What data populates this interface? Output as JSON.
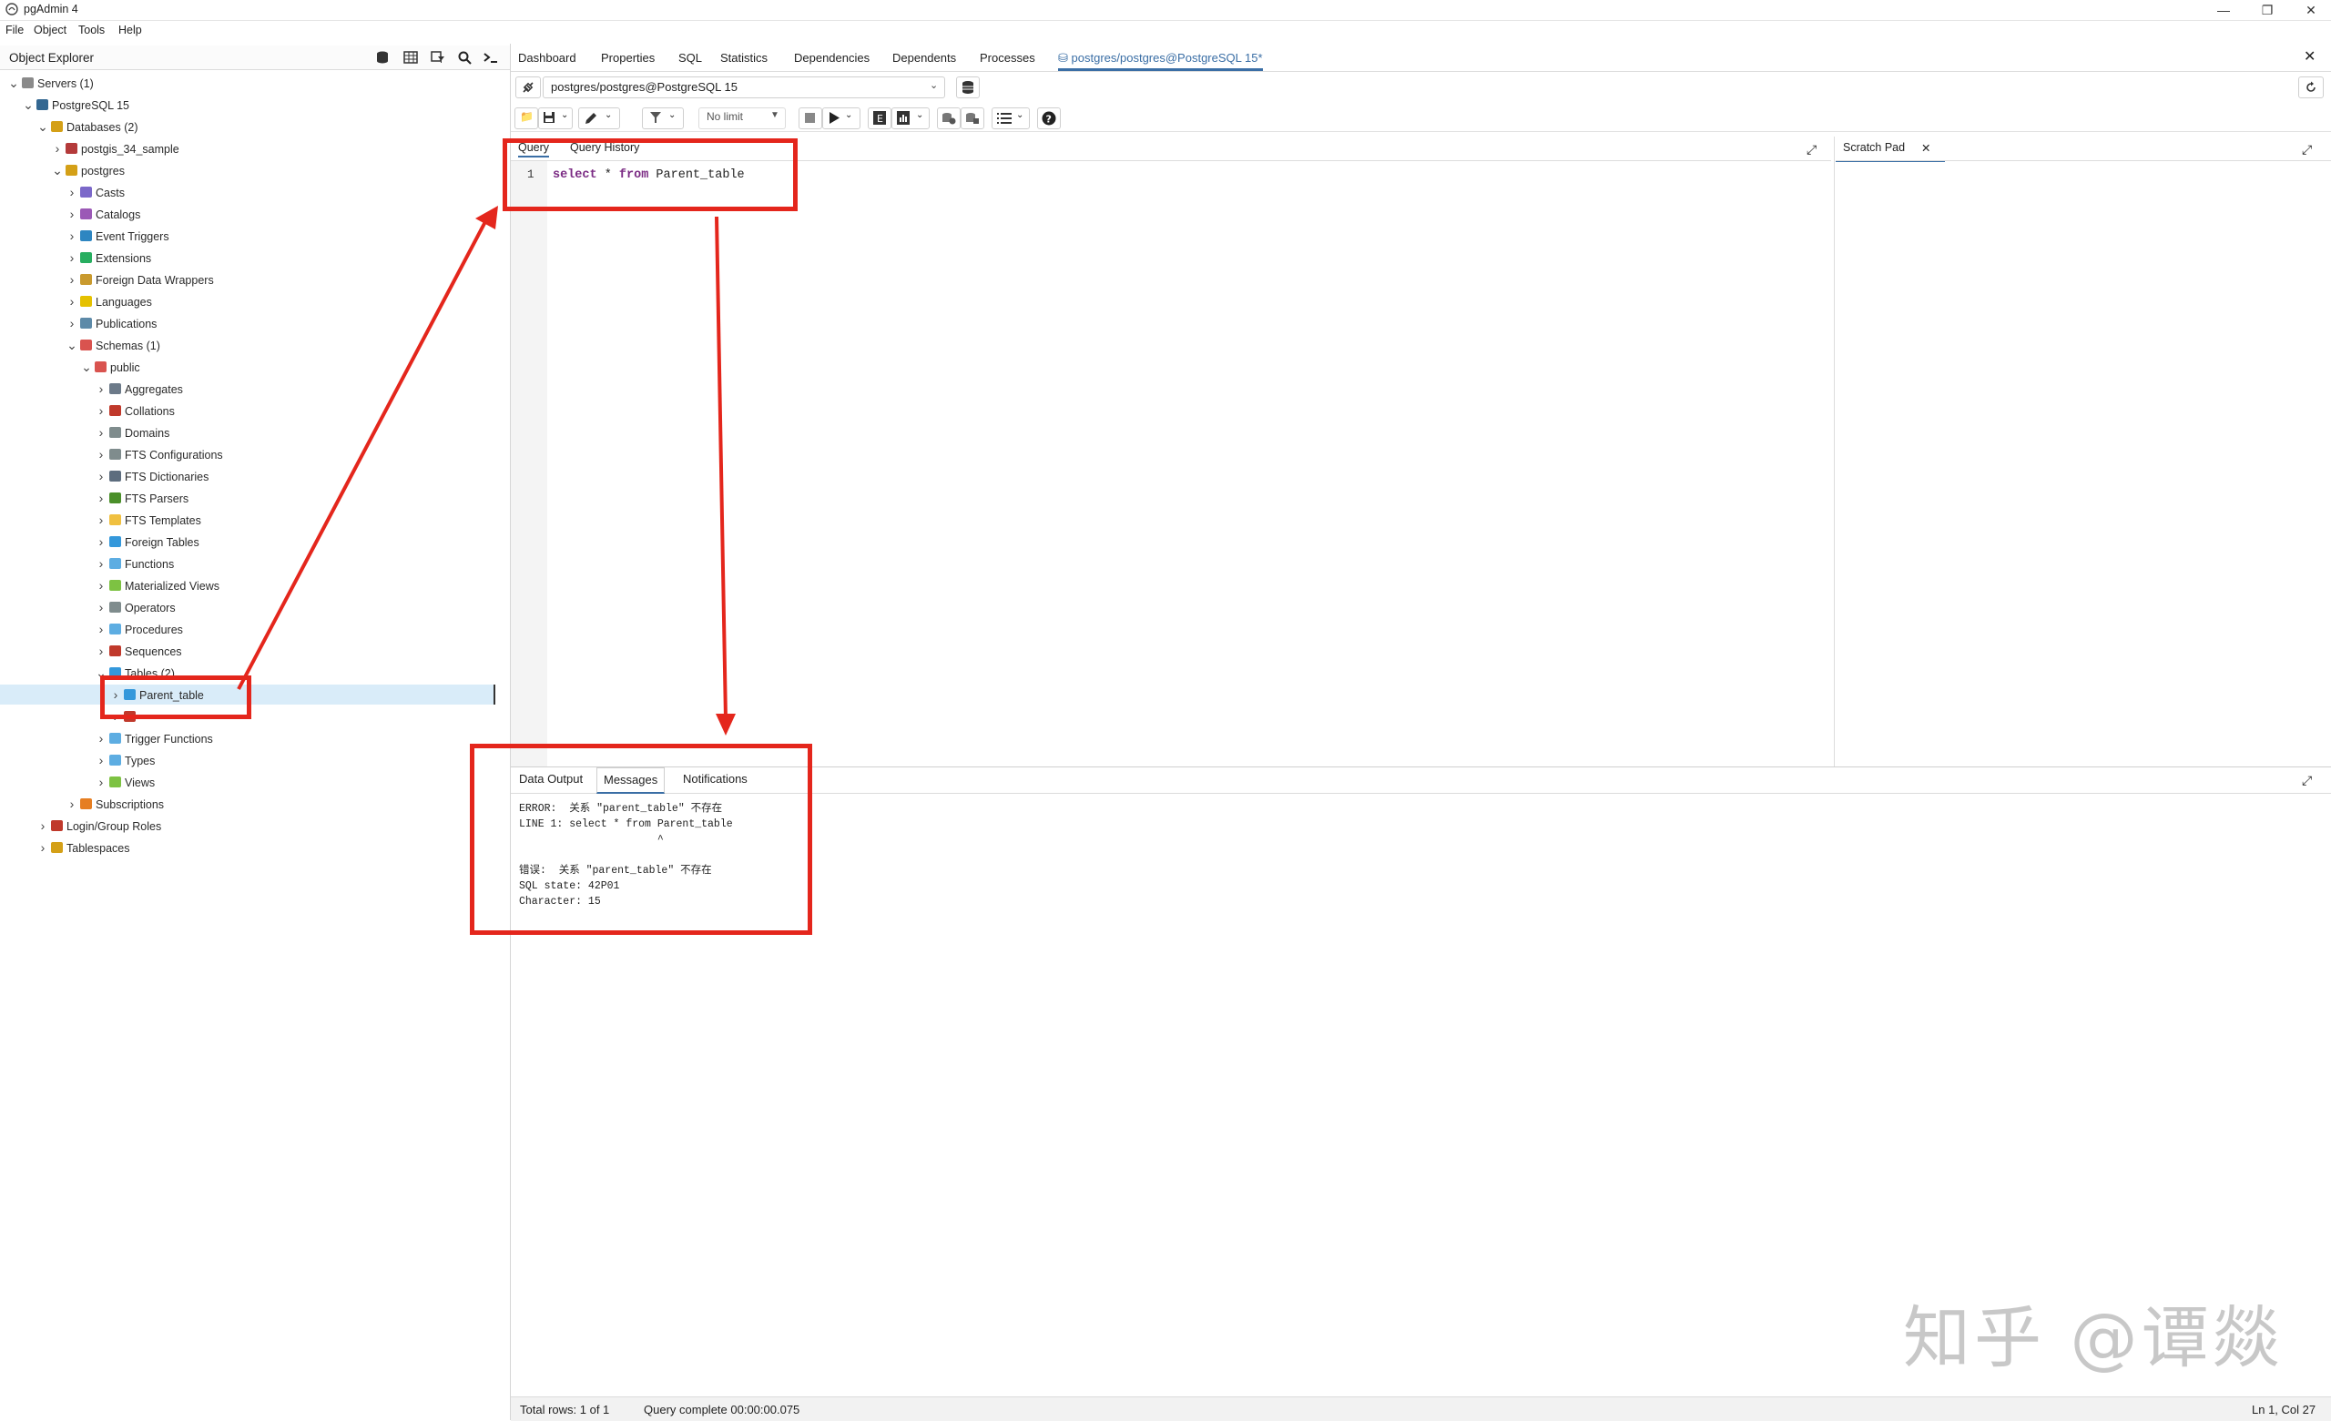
{
  "window": {
    "title": "pgAdmin 4",
    "minimize": "—",
    "restore": "❐",
    "close": "✕"
  },
  "menu": [
    "File",
    "Object",
    "Tools",
    "Help"
  ],
  "explorer": {
    "title": "Object Explorer",
    "tree": [
      {
        "label": "Servers (1)",
        "depth": 0,
        "expander": "v",
        "icon": "server-group-icon",
        "color": "#8a8a8a"
      },
      {
        "label": "PostgreSQL 15",
        "depth": 1,
        "expander": "v",
        "icon": "elephant-icon",
        "color": "#336791"
      },
      {
        "label": "Databases (2)",
        "depth": 2,
        "expander": "v",
        "icon": "database-group-icon",
        "color": "#d4a017"
      },
      {
        "label": "postgis_34_sample",
        "depth": 3,
        "expander": ">",
        "icon": "database-icon",
        "color": "#b43a3a"
      },
      {
        "label": "postgres",
        "depth": 3,
        "expander": "v",
        "icon": "database-icon",
        "color": "#d4a017"
      },
      {
        "label": "Casts",
        "depth": 4,
        "expander": ">",
        "icon": "casts-icon",
        "color": "#7b68c9"
      },
      {
        "label": "Catalogs",
        "depth": 4,
        "expander": ">",
        "icon": "catalogs-icon",
        "color": "#9b59b6"
      },
      {
        "label": "Event Triggers",
        "depth": 4,
        "expander": ">",
        "icon": "event-trigger-icon",
        "color": "#2e86c1"
      },
      {
        "label": "Extensions",
        "depth": 4,
        "expander": ">",
        "icon": "extensions-icon",
        "color": "#27ae60"
      },
      {
        "label": "Foreign Data Wrappers",
        "depth": 4,
        "expander": ">",
        "icon": "fdw-icon",
        "color": "#c99a2e"
      },
      {
        "label": "Languages",
        "depth": 4,
        "expander": ">",
        "icon": "languages-icon",
        "color": "#e5c100"
      },
      {
        "label": "Publications",
        "depth": 4,
        "expander": ">",
        "icon": "publications-icon",
        "color": "#5d8aa8"
      },
      {
        "label": "Schemas (1)",
        "depth": 4,
        "expander": "v",
        "icon": "schemas-icon",
        "color": "#d9534f"
      },
      {
        "label": "public",
        "depth": 5,
        "expander": "v",
        "icon": "schema-icon",
        "color": "#d9534f"
      },
      {
        "label": "Aggregates",
        "depth": 6,
        "expander": ">",
        "icon": "aggregates-icon",
        "color": "#6c7a89"
      },
      {
        "label": "Collations",
        "depth": 6,
        "expander": ">",
        "icon": "collations-icon",
        "color": "#c0392b"
      },
      {
        "label": "Domains",
        "depth": 6,
        "expander": ">",
        "icon": "domains-icon",
        "color": "#7f8c8d"
      },
      {
        "label": "FTS Configurations",
        "depth": 6,
        "expander": ">",
        "icon": "fts-config-icon",
        "color": "#7f8c8d"
      },
      {
        "label": "FTS Dictionaries",
        "depth": 6,
        "expander": ">",
        "icon": "fts-dictionary-icon",
        "color": "#5d6d7e"
      },
      {
        "label": "FTS Parsers",
        "depth": 6,
        "expander": ">",
        "icon": "fts-parser-icon",
        "color": "#4a8f29"
      },
      {
        "label": "FTS Templates",
        "depth": 6,
        "expander": ">",
        "icon": "fts-template-icon",
        "color": "#f0c040"
      },
      {
        "label": "Foreign Tables",
        "depth": 6,
        "expander": ">",
        "icon": "foreign-table-icon",
        "color": "#3498db"
      },
      {
        "label": "Functions",
        "depth": 6,
        "expander": ">",
        "icon": "functions-icon",
        "color": "#5dade2"
      },
      {
        "label": "Materialized Views",
        "depth": 6,
        "expander": ">",
        "icon": "mview-icon",
        "color": "#7dc242"
      },
      {
        "label": "Operators",
        "depth": 6,
        "expander": ">",
        "icon": "operators-icon",
        "color": "#7f8c8d"
      },
      {
        "label": "Procedures",
        "depth": 6,
        "expander": ">",
        "icon": "procedures-icon",
        "color": "#5dade2"
      },
      {
        "label": "Sequences",
        "depth": 6,
        "expander": ">",
        "icon": "sequences-icon",
        "color": "#c0392b"
      },
      {
        "label": "Tables (2)",
        "depth": 6,
        "expander": "v",
        "icon": "tables-icon",
        "color": "#3498db"
      },
      {
        "label": "Parent_table",
        "depth": 7,
        "expander": ">",
        "icon": "table-icon",
        "color": "#3498db",
        "selected": true
      },
      {
        "label": "",
        "depth": 7,
        "expander": ">",
        "icon": "table-icon",
        "color": "#c0392b"
      },
      {
        "label": "Trigger Functions",
        "depth": 6,
        "expander": ">",
        "icon": "trigger-functions-icon",
        "color": "#5dade2"
      },
      {
        "label": "Types",
        "depth": 6,
        "expander": ">",
        "icon": "types-icon",
        "color": "#5dade2"
      },
      {
        "label": "Views",
        "depth": 6,
        "expander": ">",
        "icon": "views-icon",
        "color": "#7dc242"
      },
      {
        "label": "Subscriptions",
        "depth": 4,
        "expander": ">",
        "icon": "subscriptions-icon",
        "color": "#e67e22"
      },
      {
        "label": "Login/Group Roles",
        "depth": 2,
        "expander": ">",
        "icon": "roles-icon",
        "color": "#c0392b"
      },
      {
        "label": "Tablespaces",
        "depth": 2,
        "expander": ">",
        "icon": "tablespaces-icon",
        "color": "#d4a017"
      }
    ]
  },
  "main_tabs": [
    {
      "label": "Dashboard"
    },
    {
      "label": "Properties"
    },
    {
      "label": "SQL"
    },
    {
      "label": "Statistics"
    },
    {
      "label": "Dependencies"
    },
    {
      "label": "Dependents"
    },
    {
      "label": "Processes"
    },
    {
      "label": "postgres/postgres@PostgreSQL 15*",
      "active": true
    }
  ],
  "connection": {
    "value": "postgres/postgres@PostgreSQL 15"
  },
  "toolbar": {
    "limit": "No limit"
  },
  "editor": {
    "tabs": [
      "Query",
      "Query History"
    ],
    "line_number": "1",
    "code": {
      "kw1": "select",
      "mid": " * ",
      "kw2": "from",
      "rest": " Parent_table"
    },
    "scratch_pad": "Scratch Pad",
    "scratch_close": "✕"
  },
  "results": {
    "tabs": [
      "Data Output",
      "Messages",
      "Notifications"
    ],
    "active_tab": "Messages",
    "message_lines": [
      "ERROR:  关系 \"parent_table\" 不存在",
      "LINE 1: select * from Parent_table",
      "                      ^",
      "",
      "错误:  关系 \"parent_table\" 不存在",
      "SQL state: 42P01",
      "Character: 15"
    ]
  },
  "status": {
    "rows": "Total rows: 1 of 1",
    "query": "Query complete 00:00:00.075",
    "position": "Ln 1, Col 27"
  },
  "watermark": "知乎 @谭燚",
  "colors": {
    "accent": "#3a6ea5",
    "annotation": "#e4261c",
    "keyword": "#7a2a83"
  }
}
